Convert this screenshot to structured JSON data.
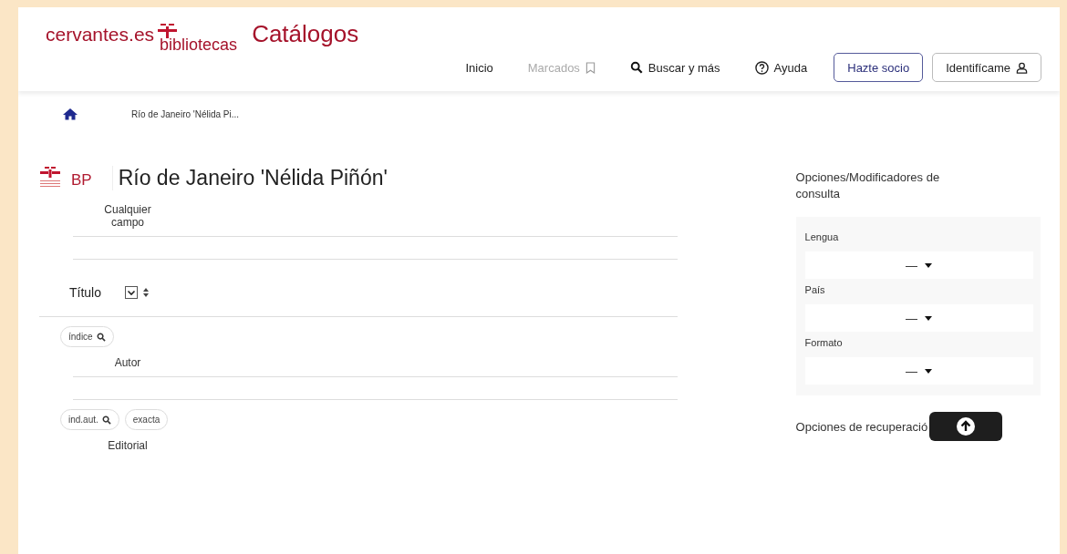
{
  "header": {
    "brand": "cervantes.es",
    "brand_sub": "bibliotecas",
    "title": "Catálogos",
    "nav": [
      {
        "label": "Inicio",
        "kind": "link",
        "disabled": false
      },
      {
        "label": "Marcados",
        "kind": "bookmarks",
        "disabled": true
      },
      {
        "label": "Buscar y más",
        "kind": "search",
        "disabled": false
      },
      {
        "label": "Ayuda",
        "kind": "help",
        "disabled": false
      }
    ],
    "buttons": [
      {
        "label": "Hazte socio",
        "kind": "primary"
      },
      {
        "label": "Identifícame",
        "kind": "user"
      }
    ]
  },
  "breadcrumb": {
    "current": "Río de Janeiro 'Nélida Pi..."
  },
  "library": {
    "code": "BP",
    "name": "Río de Janeiro 'Nélida Piñón'"
  },
  "form": [
    {
      "kind": "label",
      "label": "Cualquier campo"
    },
    {
      "kind": "field"
    },
    {
      "kind": "select",
      "value": "Título"
    },
    {
      "kind": "buttons",
      "buttons": [
        {
          "label": "índice",
          "kind": "index"
        }
      ]
    },
    {
      "kind": "label",
      "label": "Autor"
    },
    {
      "kind": "field"
    },
    {
      "kind": "buttons",
      "buttons": [
        {
          "label": "ind.aut.",
          "kind": "index"
        },
        {
          "label": "exacta",
          "kind": "exact"
        }
      ]
    },
    {
      "kind": "label",
      "label": "Editorial"
    }
  ],
  "options": {
    "title": "Opciones/Modificadores de consulta",
    "filters": [
      {
        "label": "Lengua",
        "value": "—"
      },
      {
        "label": "País",
        "value": "—"
      },
      {
        "label": "Formato",
        "value": "—"
      }
    ],
    "retrieval_title": "Opciones de recuperació"
  }
}
